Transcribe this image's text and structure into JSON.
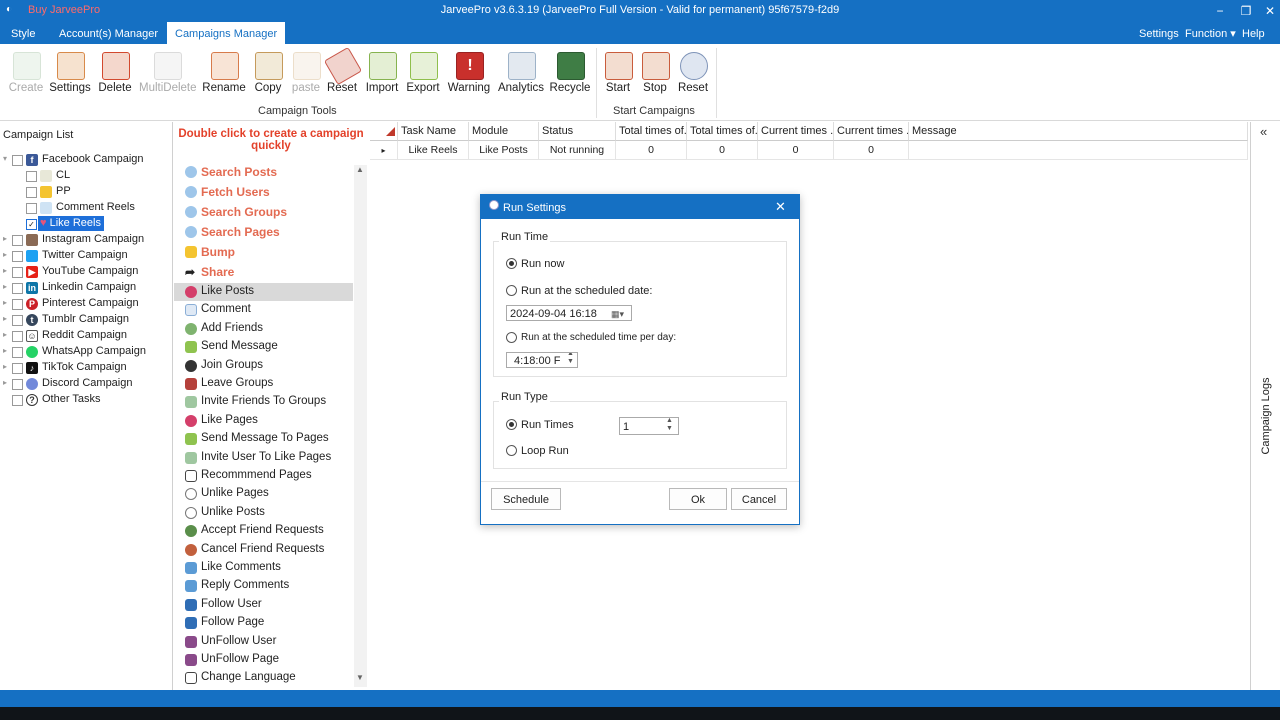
{
  "window": {
    "buy_link": "Buy JarveePro",
    "title": "JarveePro v3.6.3.19 (JarveePro Full Version - Valid for permanent) 95f67579-f2d9",
    "controls": [
      "−",
      "❐",
      "✕"
    ]
  },
  "menu": {
    "tabs": [
      "Style",
      "Account(s) Manager",
      "Campaigns Manager"
    ],
    "active_tab": "Campaigns Manager",
    "right": [
      "Settings",
      "Function ▾",
      "Help ▾"
    ]
  },
  "ribbon": {
    "campaign_tools": {
      "group_label": "Campaign Tools",
      "buttons": [
        "Create",
        "Settings",
        "Delete",
        "MultiDelete",
        "Rename",
        "Copy",
        "paste",
        "Reset",
        "Import",
        "Export",
        "Warning",
        "Analytics",
        "Recycle"
      ]
    },
    "start_campaigns": {
      "group_label": "Start Campaigns",
      "buttons": [
        "Start",
        "Stop",
        "Reset"
      ]
    }
  },
  "campaign_list": {
    "header": "Campaign List",
    "items": [
      "Facebook Campaign",
      "CL",
      "PP",
      "Comment Reels",
      "Like Reels",
      "Instagram Campaign",
      "Twitter Campaign",
      "YouTube Campaign",
      "Linkedin Campaign",
      "Pinterest Campaign",
      "Tumblr Campaign",
      "Reddit Campaign",
      "WhatsApp Campaign",
      "TikTok Campaign",
      "Discord Campaign",
      "Other Tasks"
    ]
  },
  "modules": {
    "tip": "Double click to create a campaign quickly",
    "sections": [
      "Search Posts",
      "Fetch Users",
      "Search Groups",
      "Search Pages",
      "Bump",
      "Share"
    ],
    "items": [
      "Like Posts",
      "Comment",
      "Add Friends",
      "Send Message",
      "Join Groups",
      "Leave Groups",
      "Invite Friends To Groups",
      "Like Pages",
      "Send Message To Pages",
      "Invite User To Like Pages",
      "Recommmend Pages",
      "Unlike Pages",
      "Unlike Posts",
      "Accept Friend Requests",
      "Cancel Friend Requests",
      "Like Comments",
      "Reply Comments",
      "Follow User",
      "Follow Page",
      "UnFollow User",
      "UnFollow Page",
      "Change Language"
    ]
  },
  "grid": {
    "columns": [
      "Task Name",
      "Module",
      "Status",
      "Total times of...",
      "Total times of...",
      "Current times ...",
      "Current times ...",
      "Message"
    ],
    "rows": [
      [
        "Like Reels",
        "Like Posts",
        "Not running",
        "0",
        "0",
        "0",
        "0",
        ""
      ]
    ]
  },
  "logs_label": "Campaign Logs",
  "collapse_glyph": "«",
  "dialog": {
    "title": "Run Settings",
    "run_time": {
      "label": "Run Time",
      "run_now": "Run now",
      "scheduled_date": "Run at the scheduled date:",
      "date_value": "2024-09-04 16:18",
      "scheduled_time": "Run at the scheduled time per day:",
      "time_value": "4:18:00 F"
    },
    "run_type": {
      "label": "Run Type",
      "run_times": "Run Times",
      "run_times_value": "1",
      "loop_run": "Loop Run"
    },
    "buttons": {
      "schedule": "Schedule",
      "ok": "Ok",
      "cancel": "Cancel"
    },
    "close": "✕"
  }
}
